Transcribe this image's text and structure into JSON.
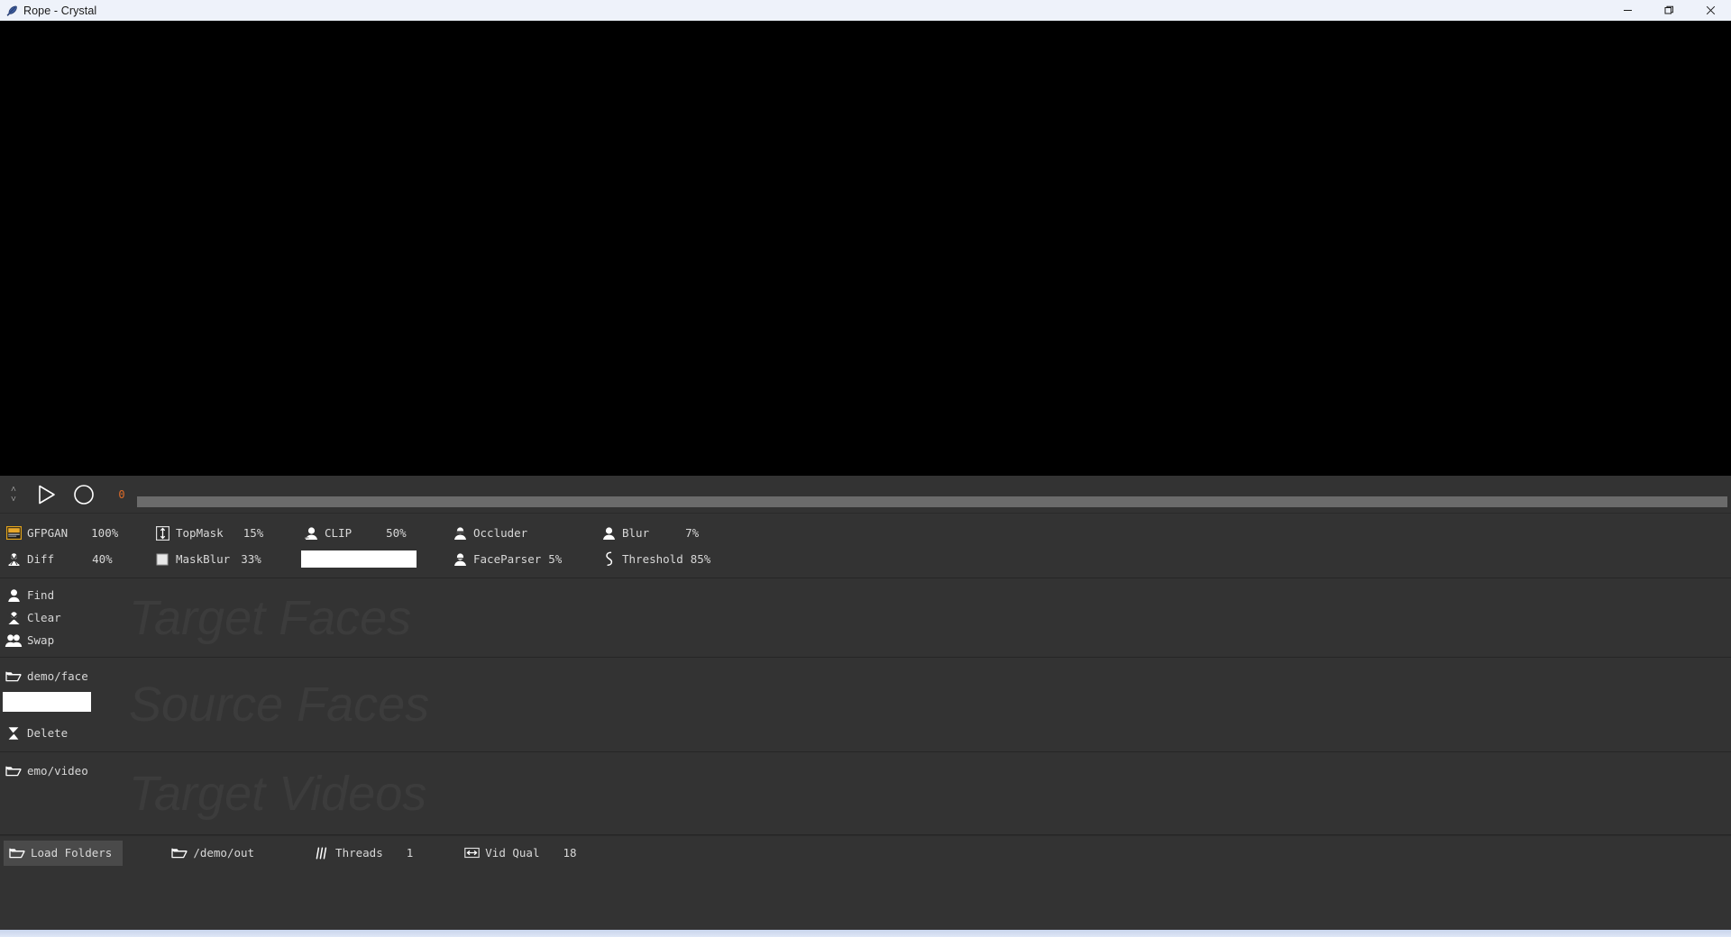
{
  "window": {
    "title": "Rope - Crystal",
    "app_icon": "feather-icon",
    "controls": {
      "minimize": "─",
      "maximize": "❐",
      "close": "✕"
    }
  },
  "preview": {
    "label": "video-preview",
    "background": "#000000"
  },
  "transport": {
    "nudge_up": "˄",
    "nudge_down": "˅",
    "play_label": "play",
    "record_label": "record",
    "frame_number": "0",
    "frame_color": "#e06c28",
    "scrub_position": 0
  },
  "params": {
    "row1": [
      {
        "icon": "gfpgan-icon",
        "label": "GFPGAN",
        "value": "100%"
      },
      {
        "icon": "topmask-icon",
        "label": "TopMask",
        "value": "15%"
      },
      {
        "icon": "clip-icon",
        "label": "CLIP",
        "value": "50%"
      },
      {
        "icon": "occluder-icon",
        "label": "Occluder",
        "value": ""
      },
      {
        "icon": "blur-icon",
        "label": "Blur",
        "value": "7%"
      }
    ],
    "row2": [
      {
        "icon": "diff-icon",
        "label": "Diff",
        "value": "40%"
      },
      {
        "icon": "maskblur-icon",
        "label": "MaskBlur",
        "value": "33%"
      },
      {
        "icon": "",
        "label": "",
        "value": ""
      },
      {
        "icon": "faceparser-icon",
        "label": "FaceParser",
        "value": "5%"
      },
      {
        "icon": "threshold-icon",
        "label": "Threshold",
        "value": "85%"
      }
    ],
    "clip_text": "",
    "clip_placeholder": ""
  },
  "target_faces": {
    "placeholder": "Target Faces",
    "buttons": [
      {
        "icon": "person-icon",
        "label": "Find"
      },
      {
        "icon": "person-clear-icon",
        "label": "Clear"
      },
      {
        "icon": "person-swap-icon",
        "label": "Swap"
      }
    ]
  },
  "source_faces": {
    "placeholder": "Source Faces",
    "folder": {
      "icon": "folder-icon",
      "label": "demo/face"
    },
    "search_value": "",
    "search_placeholder": "",
    "delete": {
      "icon": "delete-icon",
      "label": "Delete"
    }
  },
  "target_videos": {
    "placeholder": "Target Videos",
    "folder": {
      "icon": "folder-icon",
      "label": "emo/video"
    }
  },
  "bottombar": {
    "load_folders": {
      "icon": "folder-icon",
      "label": "Load Folders"
    },
    "output_folder": {
      "icon": "folder-icon",
      "label": "/demo/out"
    },
    "threads": {
      "icon": "threads-icon",
      "label": "Threads",
      "value": "1"
    },
    "vid_qual": {
      "icon": "vidqual-icon",
      "label": "Vid Qual",
      "value": "18"
    }
  },
  "colors": {
    "panel_bg": "#333333",
    "preview_bg": "#000000",
    "titlebar_bg": "#eef2fa",
    "text": "#d8d8d8",
    "placeholder_text": "#3c3c3c",
    "accent_orange": "#e06c28",
    "scrub_track": "#6b6b6b",
    "active_button": "#4a4a4a"
  }
}
